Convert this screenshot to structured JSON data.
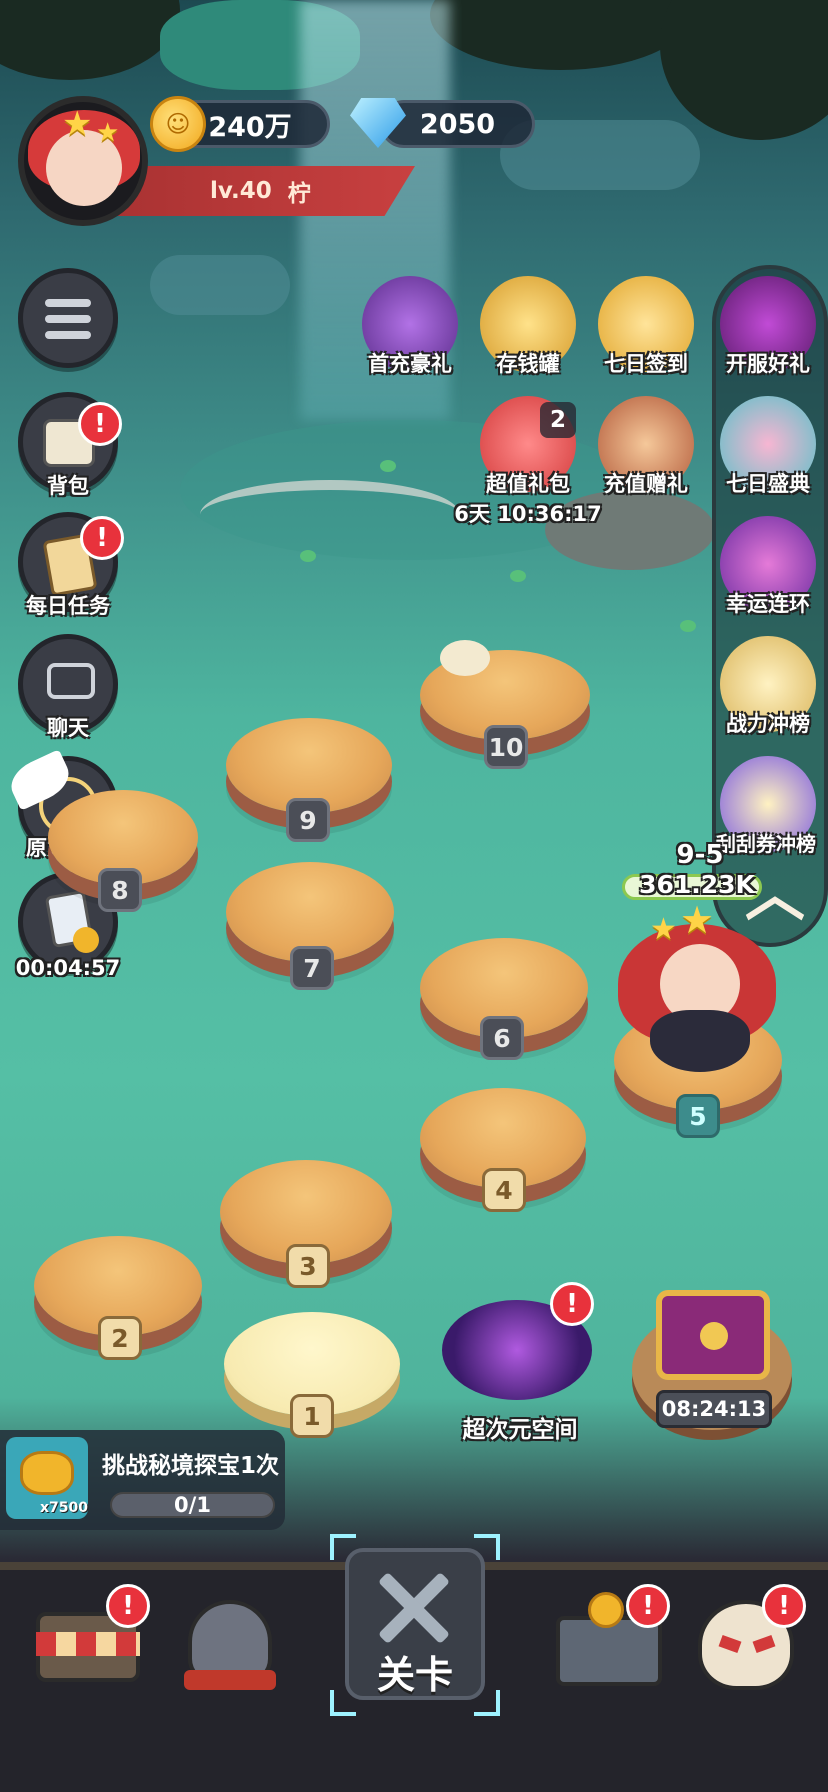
{
  "top_bar": {
    "gold": "240万",
    "diamonds": "2050",
    "level": "lv.40",
    "player_name": "柠"
  },
  "left_menu": {
    "bag_label": "背包",
    "daily_tasks_label": "每日任务",
    "chat_label": "聊天",
    "force_awaken_label": "原力觉醒",
    "ad_timer": "00:04:57"
  },
  "events": {
    "first_recharge": "首充豪礼",
    "piggy_bank": "存钱罐",
    "seven_day_checkin": "七日签到",
    "value_pack": "超值礼包",
    "value_pack_count": "2",
    "value_pack_timer": "6天 10:36:17",
    "recharge_gift": "充值赠礼"
  },
  "right_rail": {
    "server_gift": "开服好礼",
    "seven_day_festival": "七日盛典",
    "lucky_chain": "幸运连环",
    "power_rank": "战力冲榜",
    "scratch_rank": "刮刮券冲榜"
  },
  "map": {
    "current_stage": "9-5",
    "power": "361.23K",
    "stages": [
      "1",
      "2",
      "3",
      "4",
      "5",
      "6",
      "7",
      "8",
      "9",
      "10"
    ],
    "dimension_space": "超次元空间",
    "chest_timer": "08:24:13"
  },
  "quest": {
    "title": "挑战秘境探宝1次",
    "reward_count": "x7500",
    "progress_text": "0/1",
    "progress": 0
  },
  "bottom_nav": {
    "center_label": "关卡"
  },
  "colors": {
    "badge": "#e8323c",
    "level_banner": "#c84040",
    "accent_cyan": "#9ef2ff"
  }
}
